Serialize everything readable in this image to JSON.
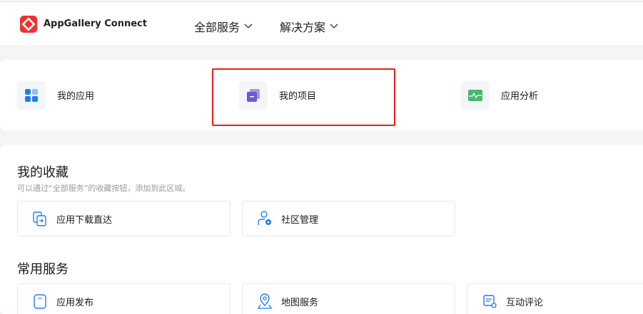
{
  "header": {
    "brand": "AppGallery Connect",
    "nav": [
      {
        "label": "全部服务"
      },
      {
        "label": "解决方案"
      }
    ]
  },
  "quick": [
    {
      "label": "我的应用",
      "icon": "apps-icon"
    },
    {
      "label": "我的项目",
      "icon": "project-icon"
    },
    {
      "label": "应用分析",
      "icon": "analytics-icon"
    }
  ],
  "favorites": {
    "title": "我的收藏",
    "subtitle": "可以通过“全部服务”的收藏按钮，添加到此区域。",
    "items": [
      {
        "label": "应用下载直达"
      },
      {
        "label": "社区管理"
      }
    ]
  },
  "common": {
    "title": "常用服务",
    "items": [
      {
        "label": "应用发布"
      },
      {
        "label": "地图服务"
      },
      {
        "label": "互动评论"
      }
    ]
  },
  "colors": {
    "accent": "#1f7cf5",
    "highlight": "#f01c1c"
  }
}
